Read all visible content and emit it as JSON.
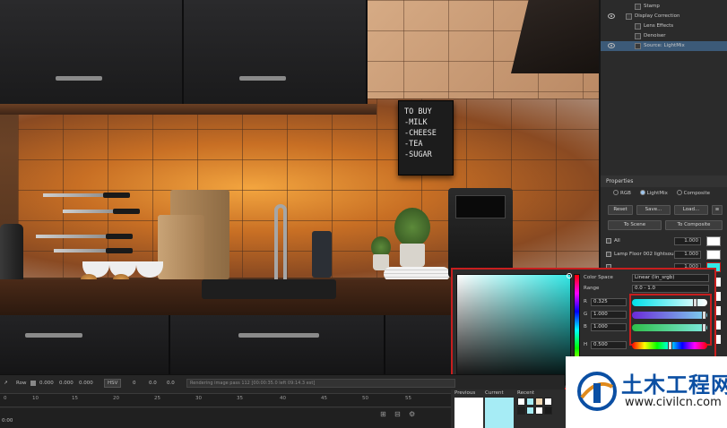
{
  "layers": {
    "items": [
      {
        "label": "Stamp"
      },
      {
        "label": "Display Correction"
      },
      {
        "label": "Lens Effects"
      },
      {
        "label": "Denoiser"
      },
      {
        "label": "Source: LightMix"
      }
    ]
  },
  "properties": {
    "title": "Properties",
    "modes": [
      "RGB",
      "LightMix",
      "Composite"
    ],
    "selected_mode": "LightMix",
    "buttons": {
      "reset": "Reset",
      "save": "Save...",
      "load": "Load...",
      "to_scene": "To Scene",
      "to_composite": "To Composite"
    },
    "lights": [
      {
        "name": "All",
        "value": "1.000"
      },
      {
        "name": "Lamp Floor 002 lightsou",
        "value": "1.000"
      },
      {
        "name": "",
        "value": "1.000"
      }
    ]
  },
  "board": {
    "lines": [
      "TO BUY",
      "-MILK",
      "-CHEESE",
      "-TEA",
      "-SUGAR"
    ]
  },
  "picker": {
    "color_space_label": "Color Space",
    "color_space_value": "Linear (lin_srgb)",
    "range_label": "Range",
    "range_value": "0.0 - 1.0",
    "channels": [
      {
        "label": "R",
        "value": "0.325"
      },
      {
        "label": "G",
        "value": "1.000"
      },
      {
        "label": "B",
        "value": "1.000"
      }
    ],
    "h_label": "H",
    "h_value": "0.500",
    "current_color": "#33e8e6",
    "swatch_labels": {
      "previous": "Previous",
      "current": "Current",
      "recent": "Recent"
    },
    "previous_color": "#ffffff",
    "recent_colors": [
      "#ffffff",
      "#a6ecf5",
      "#f3d9b4",
      "#ffffff",
      "#202020",
      "#a6ecf5",
      "#ffffff",
      "#1a1a1a"
    ]
  },
  "timeline": {
    "row_label": "Row",
    "values": [
      "0.000",
      "0.000",
      "0.000"
    ],
    "mode": "HSV",
    "extra_values": [
      "0",
      "0.0",
      "0.0"
    ],
    "status": "Rendering image pass 112 [00:00:35.0 left 09:14.3 est]",
    "ticks": [
      "0",
      "10",
      "15",
      "20",
      "25",
      "30",
      "35",
      "40",
      "45",
      "50",
      "55"
    ],
    "time": "0:00"
  },
  "watermark": {
    "name": "土木工程网",
    "url": "www.civilcn.com"
  }
}
